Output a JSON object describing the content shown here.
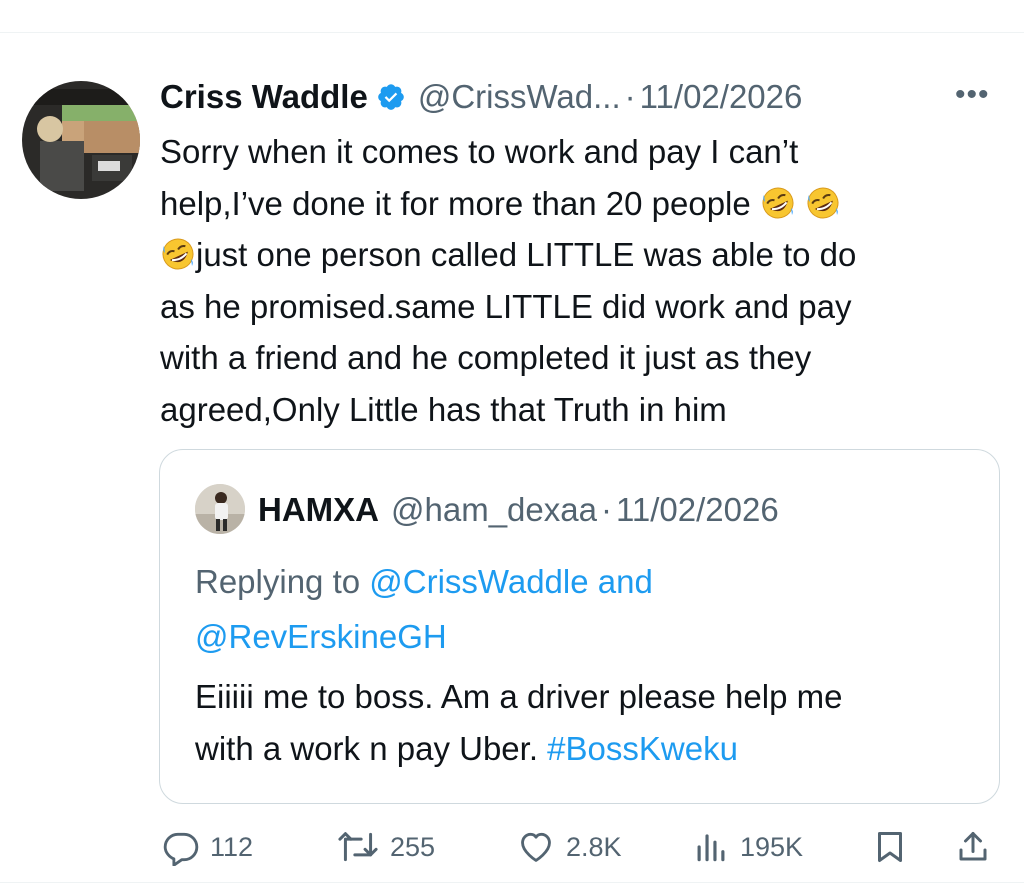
{
  "tweet": {
    "display_name": "Criss Waddle",
    "verified_icon": "verified-badge-icon",
    "handle": "@CrissWad...",
    "separator": "·",
    "date": "11/02/2026",
    "more_label": "•••",
    "text_line1": "Sorry when it comes to work and pay I can’t",
    "text_line2": "help,I’ve done it for more than 20 people",
    "text_line3": "just one person called LITTLE was able to do",
    "text_line4": "as he promised.same LITTLE did work and pay",
    "text_line5": "with a friend and he completed it just as they",
    "text_line6": "agreed,Only Little has that Truth in him",
    "emoji": "rolling-on-floor-laughing"
  },
  "quote": {
    "display_name": "HAMXA",
    "handle": "@ham_dexaa",
    "separator": "·",
    "date": "11/02/2026",
    "replying_prefix": "Replying to ",
    "mention1": "@CrissWaddle",
    "and_word": " and",
    "mention2": "@RevErskineGH",
    "text_line1": "Eiiiii me to boss. Am a driver please help me",
    "text_line2_pre": "with a work n pay Uber. ",
    "hashtag": "#BossKweku"
  },
  "actions": {
    "replies": "112",
    "reposts": "255",
    "likes": "2.8K",
    "views": "195K",
    "icons": [
      "reply-icon",
      "repost-icon",
      "like-icon",
      "views-icon",
      "bookmark-icon",
      "share-icon"
    ]
  },
  "colors": {
    "text": "#0f1419",
    "secondary": "#536471",
    "link": "#1d9bf0",
    "border": "#cfd9de"
  }
}
